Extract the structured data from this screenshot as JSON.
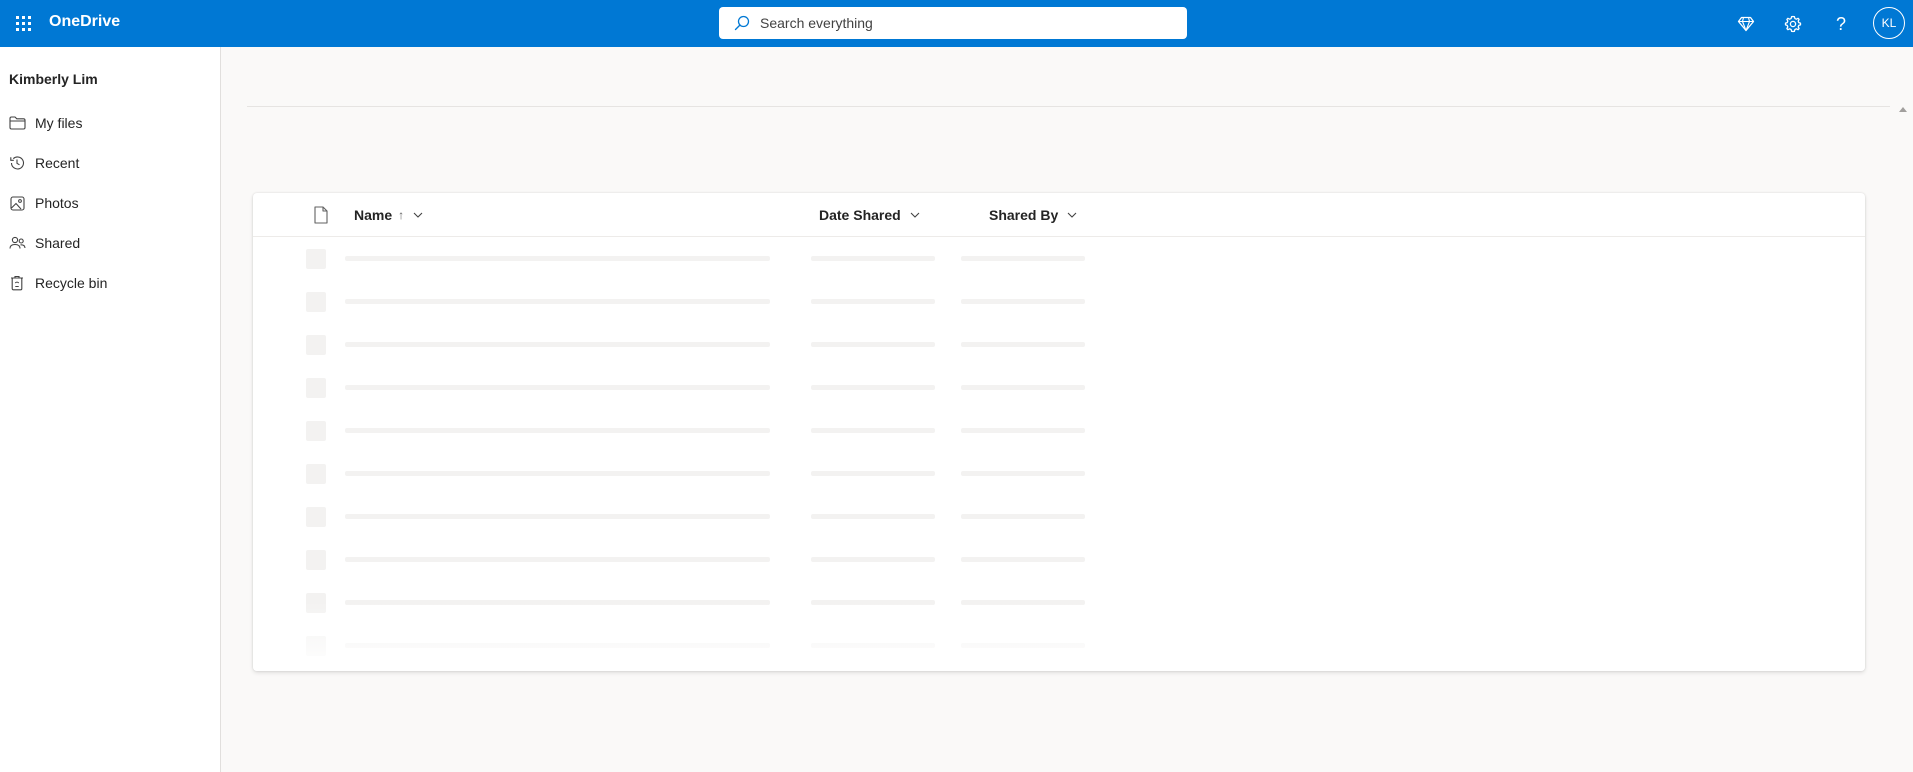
{
  "app": {
    "name": "OneDrive"
  },
  "search": {
    "placeholder": "Search everything"
  },
  "header_icons": [
    {
      "icon": "premium-diamond-icon"
    },
    {
      "icon": "gear-icon"
    },
    {
      "icon": "help-icon",
      "glyph": "?"
    }
  ],
  "user": {
    "name": "Kimberly Lim",
    "initials": "KL"
  },
  "sidebar": {
    "items": [
      {
        "label": "My files",
        "icon": "folder-icon"
      },
      {
        "label": "Recent",
        "icon": "history-icon"
      },
      {
        "label": "Photos",
        "icon": "image-icon"
      },
      {
        "label": "Shared",
        "icon": "people-icon"
      },
      {
        "label": "Recycle bin",
        "icon": "trash-icon"
      }
    ]
  },
  "table": {
    "columns": {
      "name": "Name",
      "name_sort": "↑",
      "date_shared": "Date Shared",
      "shared_by": "Shared By"
    },
    "loading_rows": 10
  },
  "colors": {
    "brand_blue": "#0078d4",
    "page_bg": "#faf9f8",
    "skeleton": "#f3f2f1"
  }
}
